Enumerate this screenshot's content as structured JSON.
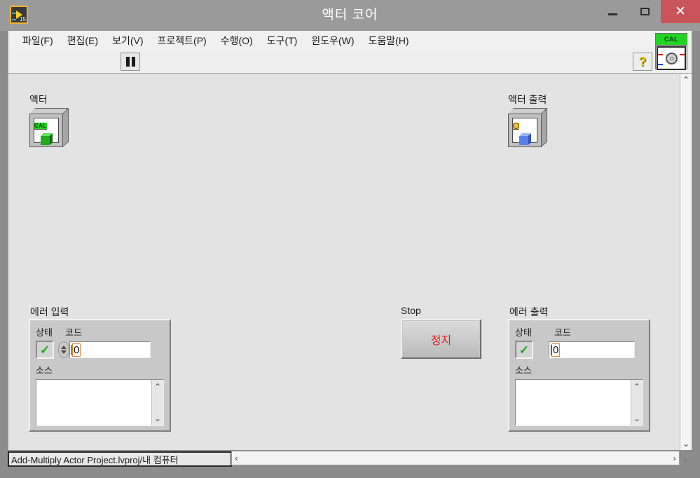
{
  "window": {
    "title": "액터 코어",
    "app_icon_name": "labview-icon",
    "app_icon_version": "15",
    "controls": {
      "minimize": "—",
      "maximize": "□",
      "close": "✕"
    }
  },
  "menubar": {
    "items": [
      {
        "label": "파일(F)",
        "name": "menu-file"
      },
      {
        "label": "편집(E)",
        "name": "menu-edit"
      },
      {
        "label": "보기(V)",
        "name": "menu-view"
      },
      {
        "label": "프로젝트(P)",
        "name": "menu-project"
      },
      {
        "label": "수행(O)",
        "name": "menu-operate"
      },
      {
        "label": "도구(T)",
        "name": "menu-tools"
      },
      {
        "label": "윈도우(W)",
        "name": "menu-window"
      },
      {
        "label": "도움말(H)",
        "name": "menu-help"
      }
    ]
  },
  "toolbar": {
    "pause_button_name": "pause-button",
    "help_button_glyph": "?",
    "cal_badge_label": "CAL"
  },
  "panel": {
    "actor_in": {
      "caption": "액터",
      "badge": "CAL"
    },
    "actor_out": {
      "caption": "액터 출력"
    },
    "error_in": {
      "caption": "에러 입력",
      "status_label": "상태",
      "code_label": "코드",
      "code_value": "0",
      "source_label": "소스",
      "source_value": ""
    },
    "error_out": {
      "caption": "에러 출력",
      "status_label": "상태",
      "code_label": "코드",
      "code_value": "0",
      "source_label": "소스",
      "source_value": ""
    },
    "stop": {
      "caption": "Stop",
      "button_label": "정지"
    }
  },
  "statusbar": {
    "path": "Add-Multiply Actor Project.lvproj/내 컴퓨터"
  },
  "scroll": {
    "up": "⌃",
    "down": "⌄",
    "left": "‹",
    "right": "›"
  },
  "colors": {
    "title_bar": "#9a9a9a",
    "close_button": "#c8555a",
    "panel_bg": "#e3e3e3",
    "cluster_bg": "#c8c8c8",
    "stop_text": "#e01b1b",
    "led_green": "#17a81a",
    "cal_green": "#22d422",
    "actor_out_gold": "#f0c240"
  }
}
